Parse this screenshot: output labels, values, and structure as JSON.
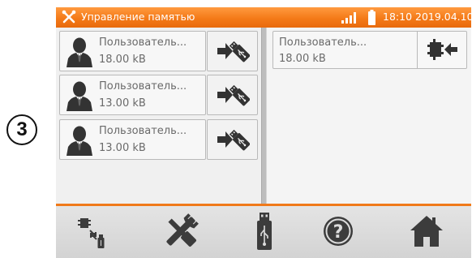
{
  "callout": {
    "number": "3"
  },
  "titlebar": {
    "title": "Управление памятью",
    "clock": "18:10 2019.04.10",
    "colors": {
      "background": "#f47a18",
      "text": "#ffffff"
    },
    "icons": [
      "tools-icon",
      "signal-icon",
      "battery-icon"
    ]
  },
  "memory_list": [
    {
      "name": "Пользователь...",
      "size": "18.00 kB",
      "action_icon": "export-to-usb-icon"
    },
    {
      "name": "Пользователь...",
      "size": "13.00 kB",
      "action_icon": "export-to-usb-icon"
    },
    {
      "name": "Пользователь...",
      "size": "13.00 kB",
      "action_icon": "export-to-usb-icon"
    }
  ],
  "device_panel": {
    "name": "Пользователь...",
    "size": "18.00 kB",
    "action_icon": "import-to-memory-icon"
  },
  "toolbar": {
    "accent": "#f07a1a",
    "buttons": [
      {
        "name": "memory-usb-transfer-button",
        "icon": "memory-usb-transfer-icon"
      },
      {
        "name": "settings-button",
        "icon": "tools-icon"
      },
      {
        "name": "usb-button",
        "icon": "usb-stick-icon"
      },
      {
        "name": "help-button",
        "icon": "help-icon"
      },
      {
        "name": "home-button",
        "icon": "home-icon"
      }
    ]
  }
}
